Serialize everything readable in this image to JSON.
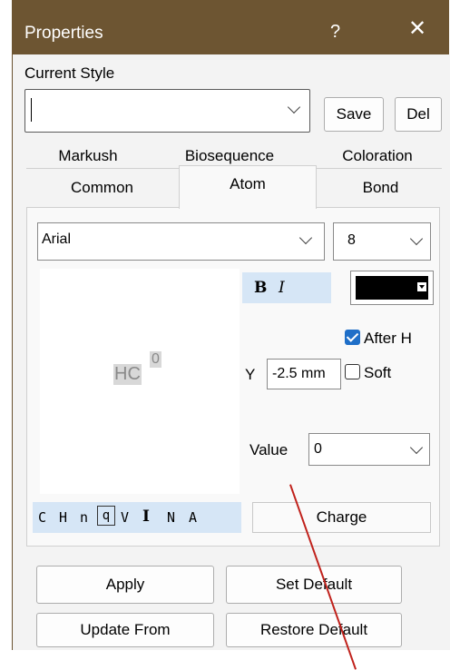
{
  "window": {
    "title": "Properties",
    "help_label": "?",
    "close_label": "✕"
  },
  "style": {
    "label": "Current Style",
    "current_value": "",
    "save_label": "Save",
    "del_label": "Del"
  },
  "tabs": {
    "row1": [
      "Markush",
      "Biosequence",
      "Coloration"
    ],
    "row2": [
      "Common",
      "Atom",
      "Bond"
    ],
    "selected": "Atom"
  },
  "atom": {
    "font_value": "Arial",
    "size_value": "8",
    "bold_label": "B",
    "italic_label": "I",
    "color": "#000000",
    "preview_text": "HC",
    "preview_superscript": "0",
    "after_h_label": "After H",
    "after_h_checked": true,
    "y_label": "Y",
    "y_value": "-2.5 mm",
    "soft_label": "Soft",
    "soft_checked": false,
    "value_label": "Value",
    "value_value": "0",
    "label_buttons": [
      "C",
      "H",
      "n",
      "q",
      "V",
      "I",
      "N",
      "A"
    ],
    "charge_label": "Charge"
  },
  "footer": {
    "apply_label": "Apply",
    "set_default_label": "Set Default",
    "update_from_label": "Update From",
    "restore_default_label": "Restore Default"
  }
}
